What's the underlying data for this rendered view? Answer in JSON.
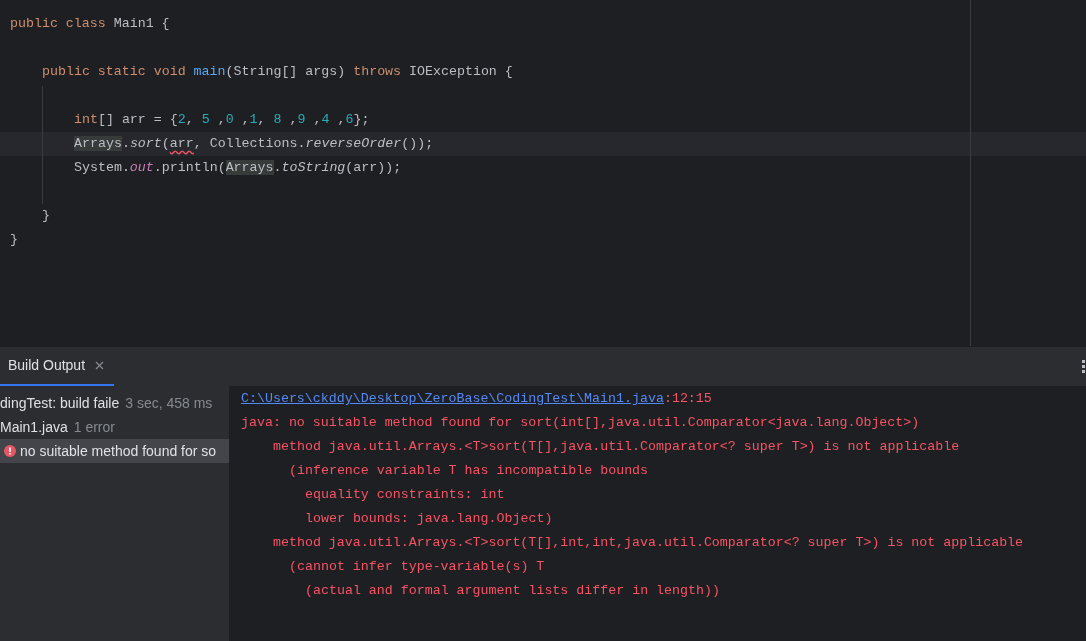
{
  "editor": {
    "lines": [
      {
        "current": false,
        "tokens": [
          {
            "t": "public class ",
            "kind": "keyword"
          },
          {
            "t": "Main1 {",
            "kind": "text"
          }
        ],
        "children": [
          {
            "current": false
          },
          {
            "current": false,
            "tokens": [
              {
                "t": "public static void ",
                "kind": "keyword"
              },
              {
                "t": "main",
                "kind": "declaration"
              },
              {
                "t": "(String[] args) ",
                "kind": "text"
              },
              {
                "t": "throws ",
                "kind": "keyword"
              },
              {
                "t": "IOException {",
                "kind": "text"
              }
            ],
            "children": [
              {
                "current": false
              },
              {
                "current": false,
                "tokens": [
                  {
                    "t": "int",
                    "kind": "keyword"
                  },
                  {
                    "t": "[] arr = {",
                    "kind": "text"
                  },
                  {
                    "t": "2",
                    "kind": "number"
                  },
                  {
                    "t": ", ",
                    "kind": "text"
                  },
                  {
                    "t": "5 ",
                    "kind": "number"
                  },
                  {
                    "t": ",",
                    "kind": "text"
                  },
                  {
                    "t": "0 ",
                    "kind": "number"
                  },
                  {
                    "t": ",",
                    "kind": "text"
                  },
                  {
                    "t": "1",
                    "kind": "number"
                  },
                  {
                    "t": ", ",
                    "kind": "text"
                  },
                  {
                    "t": "8 ",
                    "kind": "number"
                  },
                  {
                    "t": ",",
                    "kind": "text"
                  },
                  {
                    "t": "9 ",
                    "kind": "number"
                  },
                  {
                    "t": ",",
                    "kind": "text"
                  },
                  {
                    "t": "4 ",
                    "kind": "number"
                  },
                  {
                    "t": ",",
                    "kind": "text"
                  },
                  {
                    "t": "6",
                    "kind": "number"
                  },
                  {
                    "t": "};",
                    "kind": "text"
                  }
                ]
              },
              {
                "current": true,
                "tokens": [
                  {
                    "t": "Arrays",
                    "kind": "usage"
                  },
                  {
                    "t": ".",
                    "kind": "text"
                  },
                  {
                    "t": "sort",
                    "kind": "static_method"
                  },
                  {
                    "t": "(",
                    "kind": "text"
                  },
                  {
                    "t": "arr",
                    "kind": "error"
                  },
                  {
                    "t": ", Collections.",
                    "kind": "text"
                  },
                  {
                    "t": "reverseOrder",
                    "kind": "static_method"
                  },
                  {
                    "t": "());",
                    "kind": "text"
                  }
                ]
              },
              {
                "current": false,
                "tokens": [
                  {
                    "t": "System.",
                    "kind": "text"
                  },
                  {
                    "t": "out",
                    "kind": "static_field"
                  },
                  {
                    "t": ".println(",
                    "kind": "text"
                  },
                  {
                    "t": "Arrays",
                    "kind": "usage"
                  },
                  {
                    "t": ".",
                    "kind": "text"
                  },
                  {
                    "t": "toString",
                    "kind": "static_method"
                  },
                  {
                    "t": "(arr));",
                    "kind": "text"
                  }
                ]
              },
              {
                "current": false
              }
            ]
          },
          {
            "current": false,
            "tokens": [
              {
                "t": "}",
                "kind": "text"
              }
            ]
          }
        ]
      },
      {
        "current": false,
        "tokens": [
          {
            "t": "}",
            "kind": "text"
          }
        ]
      }
    ]
  },
  "panel": {
    "tabs": [
      {
        "label": "Build Output",
        "selected": true
      }
    ],
    "tree": [
      {
        "label": "dingTest:",
        "detail": "build faile",
        "meta": "3 sec, 458 ms",
        "kind": "build",
        "selected": false
      },
      {
        "label": "Main1.java",
        "meta": "1 error",
        "kind": "file",
        "selected": false
      },
      {
        "label": "no suitable method found for so",
        "kind": "error",
        "selected": true
      }
    ],
    "console": {
      "link": "C:\\Users\\ckddy\\Desktop\\ZeroBase\\CodingTest\\Main1.java",
      "location": ":12:15",
      "messages": [
        {
          "text": "java: no suitable method found for sort(int[],java.util.Comparator<java.lang.Object>)",
          "children": [
            {
              "text": "method java.util.Arrays.<T>sort(T[],java.util.Comparator<? super T>) is not applicable",
              "children": [
                {
                  "text": "(inference variable T has incompatible bounds",
                  "children": [
                    {
                      "text": "equality constraints: int"
                    },
                    {
                      "text": "lower bounds: java.lang.Object)"
                    }
                  ]
                }
              ]
            },
            {
              "text": "method java.util.Arrays.<T>sort(T[],int,int,java.util.Comparator<? super T>) is not applicable",
              "children": [
                {
                  "text": "(cannot infer type-variable(s) T",
                  "children": [
                    {
                      "text": "(actual and formal argument lists differ in length))"
                    }
                  ]
                }
              ]
            }
          ]
        }
      ]
    }
  }
}
